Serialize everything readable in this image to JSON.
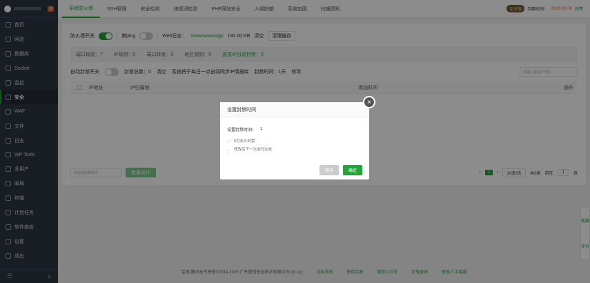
{
  "sidebar": {
    "badge": "0",
    "items": [
      {
        "label": "首页",
        "icon": "home-icon"
      },
      {
        "label": "网站",
        "icon": "globe-icon"
      },
      {
        "label": "数据库",
        "icon": "database-icon"
      },
      {
        "label": "Docker",
        "icon": "docker-icon"
      },
      {
        "label": "监控",
        "icon": "monitor-icon"
      },
      {
        "label": "安全",
        "icon": "shield-icon"
      },
      {
        "label": "WAF",
        "icon": "waf-icon"
      },
      {
        "label": "文件",
        "icon": "folder-icon"
      },
      {
        "label": "日志",
        "icon": "log-icon"
      },
      {
        "label": "WP Tools",
        "icon": "wordpress-icon"
      },
      {
        "label": "多用户",
        "icon": "users-icon"
      },
      {
        "label": "邮局",
        "icon": "mail-icon"
      },
      {
        "label": "终端",
        "icon": "terminal-icon"
      },
      {
        "label": "计划任务",
        "icon": "clock-icon"
      },
      {
        "label": "软件商店",
        "icon": "store-icon"
      },
      {
        "label": "设置",
        "icon": "gear-icon"
      },
      {
        "label": "退出",
        "icon": "logout-icon"
      }
    ],
    "active_index": 5
  },
  "tabs": [
    "系统防火墙",
    "SSH管理",
    "安全检测",
    "违规词检测",
    "PHP网站安全",
    "入侵防御",
    "系统加固",
    "扫描感知"
  ],
  "header": {
    "pro_badge": "企业版",
    "expire_label": "到期时间：",
    "expire_date": "2026-02-06",
    "renew": "续费"
  },
  "controls": {
    "firewall_label": "防火墙开关",
    "ping_label": "禁ping",
    "weblog_label": "Web日志：",
    "weblog_path": "/www/wwwlogs",
    "weblog_size": "192.00 KB",
    "clear": "清空",
    "clear_cache": "清理缓存"
  },
  "stats": {
    "port_rules": "端口规则：7",
    "ip_rules": "IP规则：0",
    "port_forward": "端口转发：0",
    "region_rules": "地区规则：0",
    "auto_ban": "恶意IP自动封禁：0"
  },
  "row3": {
    "auto_ban_switch": "自动封禁开关",
    "ban_total": "封禁总数：0",
    "clear": "清空",
    "sync_text": "系统将于每日一点自动同步IP情报库",
    "ban_time": "封禁时间：1天",
    "edit": "修改",
    "search_placeholder": "请输入查看IP地址"
  },
  "table": {
    "col_ip": "IP地址",
    "col_loc": "IP归属地",
    "col_time": "添加时间",
    "col_op": "操作"
  },
  "footer": {
    "batch_placeholder": "请选择批量操作",
    "batch_btn": "批量操作",
    "page": "1",
    "per_page": "20条/页",
    "total": "共0条",
    "goto": "前往",
    "goto_page": "1",
    "goto_unit": "页"
  },
  "copyright": {
    "text": "宝塔-腾讯云专享版©2014-2025 广东堡塔安全技术有限公司 (bt.cn)",
    "links": [
      "论坛求助",
      "使用手册",
      "微信公众号",
      "正版查询",
      "联系人工客服"
    ]
  },
  "side_tools": [
    "客服",
    "评价"
  ],
  "modal": {
    "title": "设置封禁时间",
    "field_label": "设置封禁时间：",
    "field_value": "1",
    "tips": [
      "0为永久封禁",
      "修改后下一次运行生效"
    ],
    "cancel": "取消",
    "confirm": "确定",
    "close_icon": "close-icon"
  },
  "colors": {
    "accent": "#20a53a",
    "sidebar_bg": "#2f3542",
    "warn": "#f0642d"
  }
}
